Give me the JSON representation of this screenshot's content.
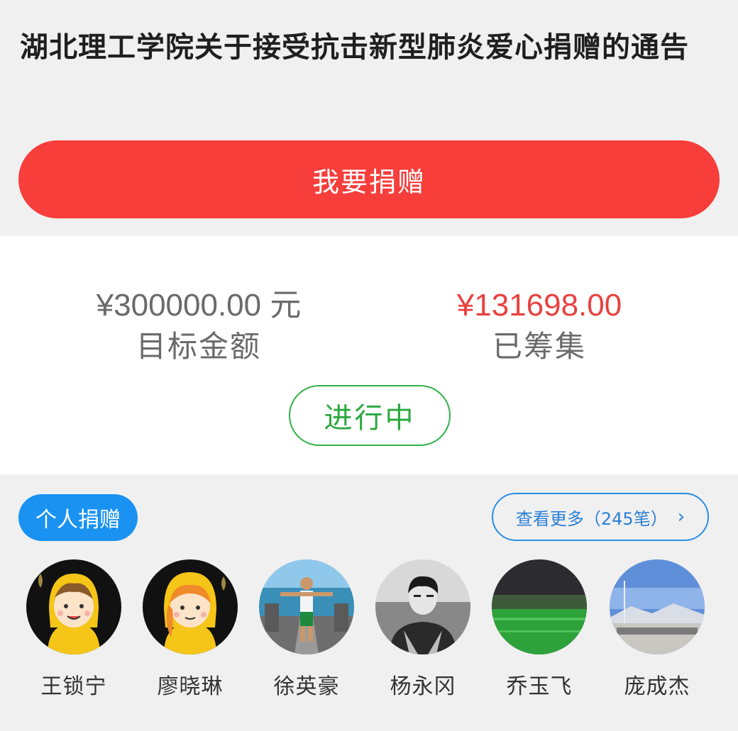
{
  "notice": {
    "title": "湖北理工学院关于接受抗击新型肺炎爱心捐赠的通告",
    "donate_label": "我要捐赠"
  },
  "stats": {
    "target_amount": "¥300000.00 元",
    "target_label": "目标金额",
    "raised_amount": "¥131698.00",
    "raised_label": "已筹集",
    "status": "进行中"
  },
  "donors": {
    "tag": "个人捐赠",
    "more_label": "查看更多（245笔）",
    "more_icon": "chevron-right-icon",
    "list": [
      {
        "name": "王锁宁"
      },
      {
        "name": "廖晓琳"
      },
      {
        "name": "徐英豪"
      },
      {
        "name": "杨永冈"
      },
      {
        "name": "乔玉飞"
      },
      {
        "name": "庞成杰"
      }
    ]
  },
  "colors": {
    "donate_button": "#f73e3b",
    "raised_amount": "#e8423f",
    "status_green": "#2aa83f",
    "tag_blue": "#1a92f2"
  }
}
